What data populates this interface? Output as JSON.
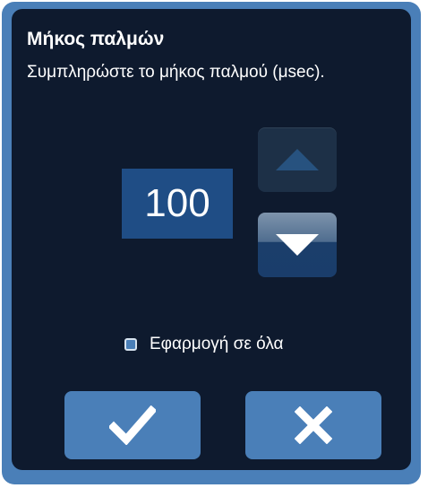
{
  "dialog": {
    "title": "Μήκος παλμών",
    "instruction": "Συμπληρώστε το μήκος παλμού (μsec).",
    "value": "100",
    "apply_all_label": "Εφαρμογή σε όλα",
    "apply_all_checked": false
  },
  "icons": {
    "increase": "triangle-up-icon",
    "decrease": "triangle-down-icon",
    "confirm": "checkmark-icon",
    "cancel": "close-icon"
  },
  "colors": {
    "frame": "#4a7fb8",
    "background": "#0e1a2e",
    "value_box": "#1f4d85",
    "text": "#ffffff"
  }
}
